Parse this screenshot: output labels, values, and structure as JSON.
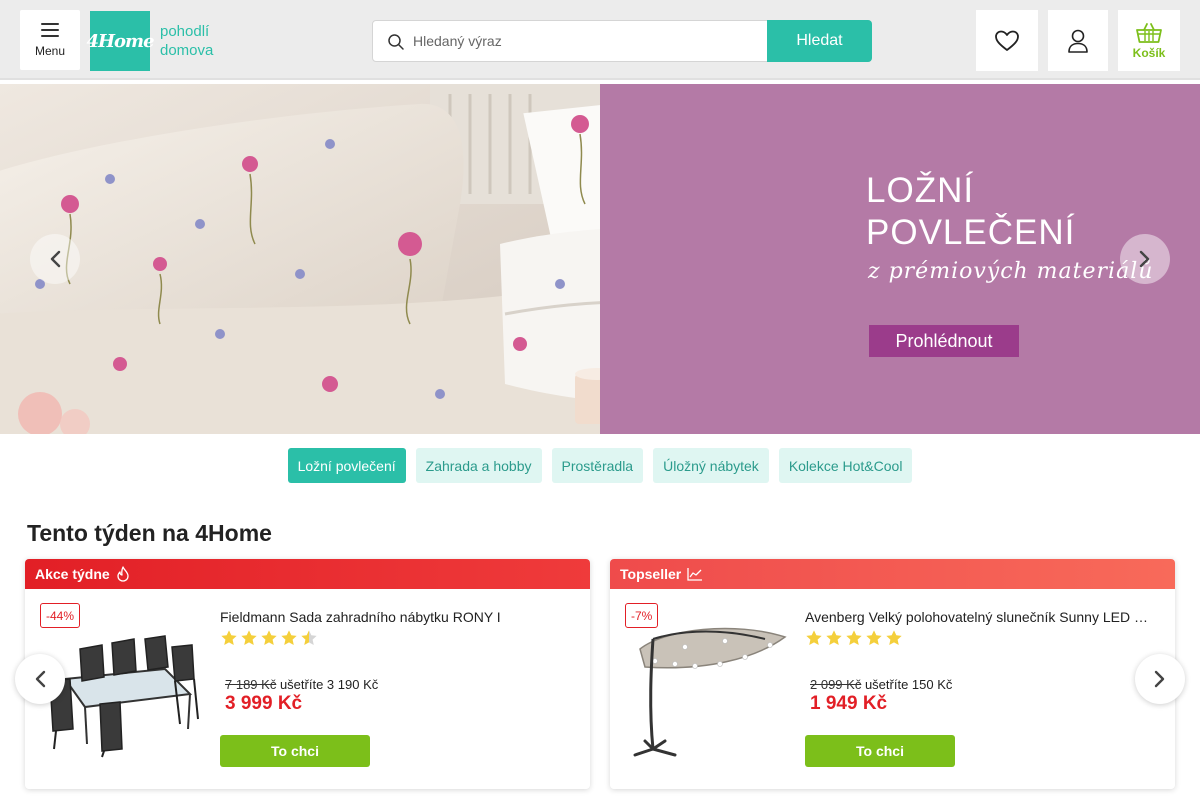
{
  "header": {
    "menu_label": "Menu",
    "logo_text": "4Home",
    "logo_tagline_1": "pohodlí",
    "logo_tagline_2": "domova",
    "search_placeholder": "Hledaný výraz",
    "search_button": "Hledat",
    "cart_label": "Košík"
  },
  "banner": {
    "title_line1": "LOŽNÍ",
    "title_line2": "POVLEČENÍ",
    "subtitle": "z prémiových materiálů",
    "cta": "Prohlédnout"
  },
  "categories": [
    "Ložní povlečení",
    "Zahrada a hobby",
    "Prostěradla",
    "Úložný nábytek",
    "Kolekce Hot&Cool"
  ],
  "section_title": "Tento týden na 4Home",
  "cards": [
    {
      "header": "Akce týdne",
      "badge": "-44%",
      "name": "Fieldmann Sada zahradního nábytku RONY I",
      "rating": 4.5,
      "old_price": "7 189 Kč",
      "savings": "ušetříte 3 190 Kč",
      "price": "3 999 Kč",
      "button": "To chci"
    },
    {
      "header": "Topseller",
      "badge": "-7%",
      "name": "Avenberg Velký polohovatelný slunečník Sunny LED …",
      "rating": 5,
      "old_price": "2 099 Kč",
      "savings": "ušetříte 150 Kč",
      "price": "1 949 Kč",
      "button": "To chci"
    }
  ],
  "colors": {
    "brand": "#2bbfa8",
    "accent_green": "#7cbf1a",
    "sale_red": "#e21f26",
    "banner_purple": "#b47aa6"
  }
}
